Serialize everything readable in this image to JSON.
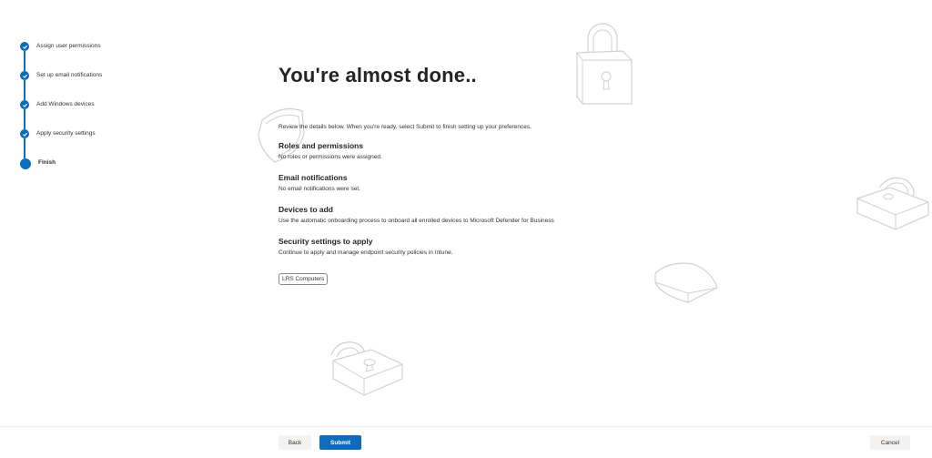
{
  "stepper": {
    "steps": [
      {
        "label": "Assign user permissions",
        "state": "done"
      },
      {
        "label": "Set up email notifications",
        "state": "done"
      },
      {
        "label": "Add Windows devices",
        "state": "done"
      },
      {
        "label": "Apply security settings",
        "state": "done"
      },
      {
        "label": "Finish",
        "state": "current"
      }
    ]
  },
  "main": {
    "title": "You're almost done..",
    "intro": "Review the details below. When you're ready, select Submit to finish setting up your preferences.",
    "sections": [
      {
        "heading": "Roles and permissions",
        "text": "No roles or permissions were assigned."
      },
      {
        "heading": "Email notifications",
        "text": "No email notifications were set."
      },
      {
        "heading": "Devices to add",
        "text": "Use the automatic onboarding process to onboard all enrolled devices to Microsoft Defender for Business"
      },
      {
        "heading": "Security settings to apply",
        "text": "Continue to apply and manage endpoint security policies in Intune."
      }
    ],
    "tag": "LRS Computers"
  },
  "footer": {
    "back_label": "Back",
    "submit_label": "Submit",
    "cancel_label": "Cancel"
  },
  "colors": {
    "accent": "#0f6cbd",
    "text": "#323130",
    "deco_stroke": "#d2d0ce"
  }
}
